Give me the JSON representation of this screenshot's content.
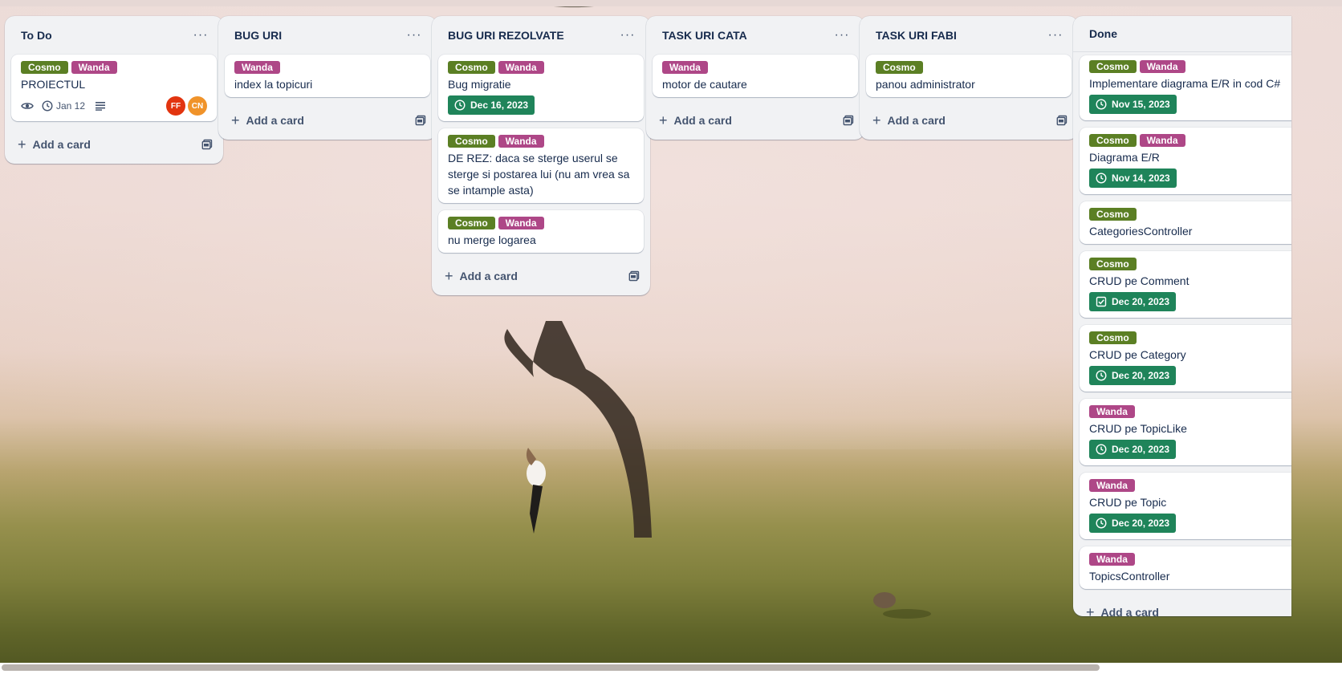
{
  "lists": [
    {
      "title": "To Do",
      "menu_glyph": "···",
      "add_label": "Add a card",
      "cards": [
        {
          "labels": [
            "Cosmo",
            "Wanda"
          ],
          "title": "PROIECTUL",
          "date": "Jan 12",
          "avatars": [
            "FF",
            "CN"
          ]
        }
      ]
    },
    {
      "title": "BUG URI",
      "menu_glyph": "···",
      "add_label": "Add a card",
      "cards": [
        {
          "labels": [
            "Wanda"
          ],
          "title": "index la topicuri"
        }
      ]
    },
    {
      "title": "BUG URI REZOLVATE",
      "menu_glyph": "···",
      "add_label": "Add a card",
      "cards": [
        {
          "labels": [
            "Cosmo",
            "Wanda"
          ],
          "title": "Bug migratie",
          "due": "Dec 16, 2023"
        },
        {
          "labels": [
            "Cosmo",
            "Wanda"
          ],
          "title": "DE REZ: daca se sterge userul se sterge si postarea lui (nu am vrea sa se intample asta)"
        },
        {
          "labels": [
            "Cosmo",
            "Wanda"
          ],
          "title": "nu merge logarea"
        }
      ]
    },
    {
      "title": "TASK URI CATA",
      "menu_glyph": "···",
      "add_label": "Add a card",
      "cards": [
        {
          "labels": [
            "Wanda"
          ],
          "title": "motor de cautare"
        }
      ]
    },
    {
      "title": "TASK URI FABI",
      "menu_glyph": "···",
      "add_label": "Add a card",
      "cards": [
        {
          "labels": [
            "Cosmo"
          ],
          "title": "panou administrator"
        }
      ]
    },
    {
      "title": "Done",
      "add_label": "Add a card",
      "cards": [
        {
          "labels": [
            "Cosmo",
            "Wanda"
          ],
          "title": "Implementare diagrama E/R in cod C#",
          "due": "Nov 15, 2023"
        },
        {
          "labels": [
            "Cosmo",
            "Wanda"
          ],
          "title": "Diagrama E/R",
          "due": "Nov 14, 2023"
        },
        {
          "labels": [
            "Cosmo"
          ],
          "title": "CategoriesController"
        },
        {
          "labels": [
            "Cosmo"
          ],
          "title": "CRUD pe Comment",
          "due": "Dec 20, 2023",
          "due_icon": "checkbox"
        },
        {
          "labels": [
            "Cosmo"
          ],
          "title": "CRUD pe Category",
          "due": "Dec 20, 2023"
        },
        {
          "labels": [
            "Wanda"
          ],
          "title": "CRUD pe TopicLike",
          "due": "Dec 20, 2023"
        },
        {
          "labels": [
            "Wanda"
          ],
          "title": "CRUD pe Topic",
          "due": "Dec 20, 2023"
        },
        {
          "labels": [
            "Wanda"
          ],
          "title": "TopicsController"
        }
      ]
    }
  ],
  "colors": {
    "label_green": "#5b7f24",
    "label_pink": "#ae4787",
    "due_complete": "#1f845a",
    "avatar_ff": "#e2340f",
    "avatar_cn": "#f0932a"
  },
  "icons": {
    "watch": "eye-icon",
    "clock": "clock-icon",
    "description": "description-lines-icon",
    "plus": "plus-icon",
    "template": "card-template-icon",
    "checkbox": "checkbox-icon"
  }
}
